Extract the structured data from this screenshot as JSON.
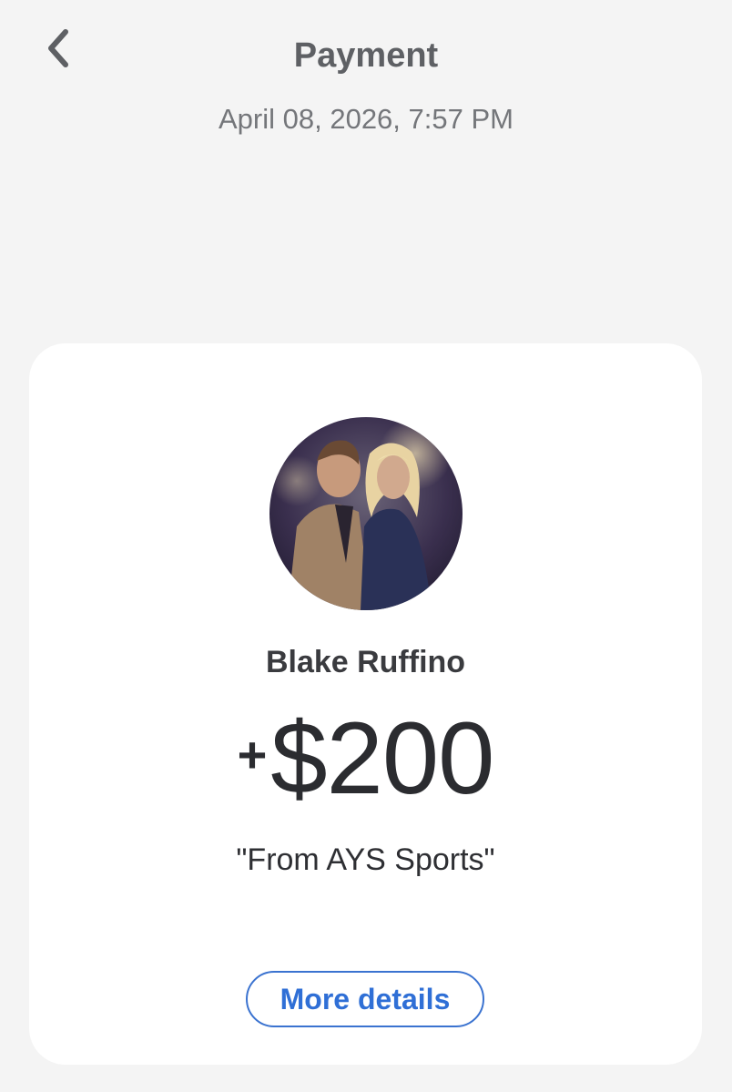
{
  "header": {
    "back_icon": "chevron-left-icon",
    "title": "Payment",
    "timestamp": "April 08, 2026, 7:57 PM"
  },
  "transaction": {
    "avatar_icon": "profile-photo",
    "sender_name": "Blake Ruffino",
    "amount_sign": "+",
    "amount_value": "$200",
    "memo": "\"From AYS Sports\"",
    "details_button_label": "More details"
  },
  "colors": {
    "background": "#f4f4f4",
    "card": "#ffffff",
    "link_blue": "#2f6fd6",
    "text_dark": "#2b2c30",
    "text_muted": "#74767a"
  }
}
